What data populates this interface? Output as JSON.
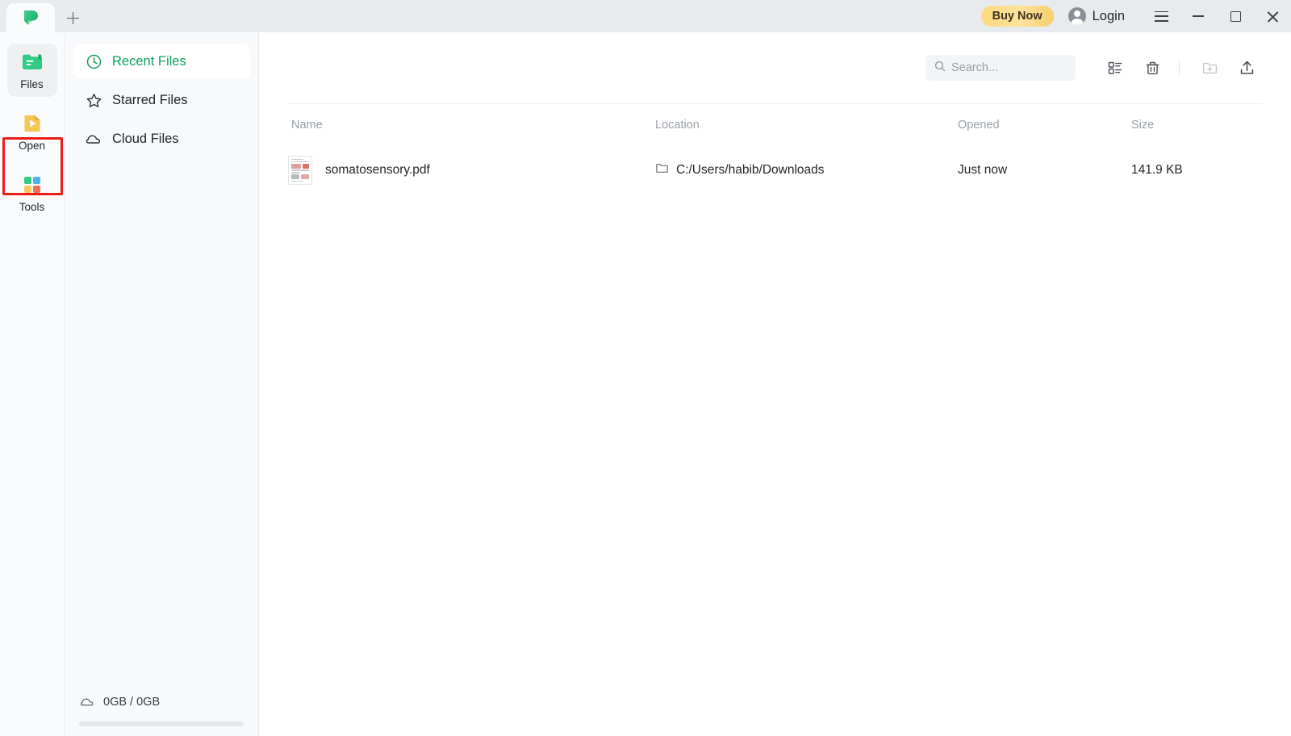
{
  "titlebar": {
    "tab_logo_name": "updf-logo",
    "new_tab_label": "+",
    "buy_now_label": "Buy Now",
    "login_label": "Login",
    "menu_icon": "hamburger-icon",
    "minimize_icon": "minimize-icon",
    "maximize_icon": "maximize-icon",
    "close_icon": "close-icon"
  },
  "rail": {
    "items": [
      {
        "label": "Files",
        "icon": "files-folder-icon",
        "active": true
      },
      {
        "label": "Open",
        "icon": "open-file-icon",
        "active": false,
        "highlighted": true
      },
      {
        "label": "Tools",
        "icon": "tools-grid-icon",
        "active": false
      }
    ]
  },
  "sidebar": {
    "items": [
      {
        "label": "Recent Files",
        "icon": "clock-icon",
        "active": true
      },
      {
        "label": "Starred Files",
        "icon": "star-icon",
        "active": false
      },
      {
        "label": "Cloud Files",
        "icon": "cloud-icon",
        "active": false
      }
    ],
    "storage": {
      "icon": "cloud-icon",
      "text": "0GB / 0GB"
    }
  },
  "toolbar": {
    "search_placeholder": "Search...",
    "search_value": "",
    "search_icon": "search-icon",
    "view_toggle_icon": "list-view-icon",
    "trash_icon": "trash-icon",
    "new_folder_icon": "new-folder-icon",
    "upload_icon": "upload-icon"
  },
  "table": {
    "headers": [
      "Name",
      "Location",
      "Opened",
      "Size"
    ],
    "rows": [
      {
        "name": "somatosensory.pdf",
        "location": "C:/Users/habib/Downloads",
        "opened": "Just now",
        "size": "141.9 KB",
        "thumb_icon": "pdf-thumbnail-icon",
        "location_icon": "folder-icon"
      }
    ]
  },
  "colors": {
    "accent_green": "#10a05f",
    "titlebar_bg": "#e8ebee",
    "sidebar_bg": "#f7f9fb",
    "highlight_red": "#ee1c17",
    "buy_now_gold": "#fbd97e"
  }
}
